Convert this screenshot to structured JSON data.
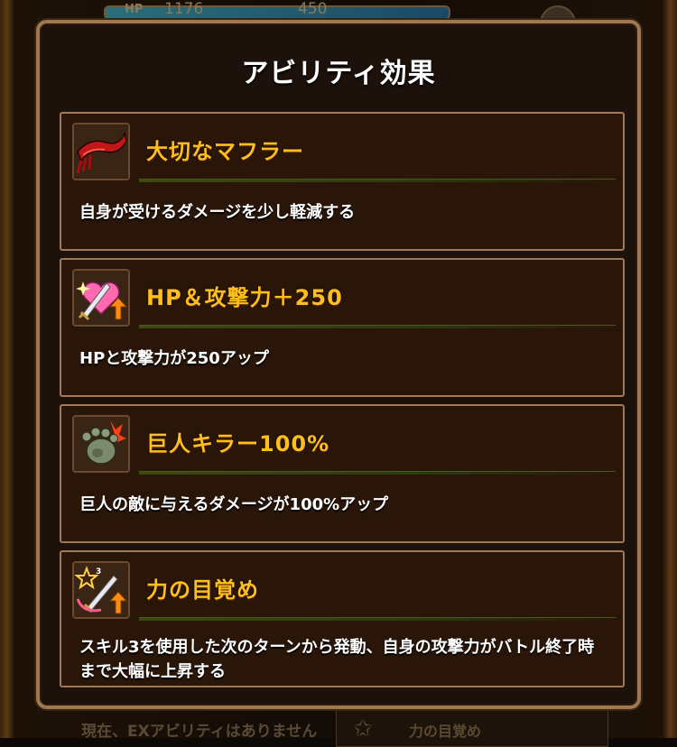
{
  "background": {
    "hp_label": "HP",
    "hp_value": "1176",
    "atk_value": "450",
    "bottom_text": "現在、EXアビリティはありません",
    "bottom_slot_text": "力の目覚め"
  },
  "dialog": {
    "title": "アビリティ効果",
    "abilities": [
      {
        "name": "大切なマフラー",
        "description": "自身が受けるダメージを少し軽減する",
        "icon": "scarf-icon"
      },
      {
        "name": "HP＆攻撃力＋250",
        "description": "HPと攻撃力が250アップ",
        "icon": "heart-sword-up-icon"
      },
      {
        "name": "巨人キラー100%",
        "description": "巨人の敵に与えるダメージが100%アップ",
        "icon": "giant-foot-icon"
      },
      {
        "name": "力の目覚め",
        "description": "スキル3を使用した次のターンから発動、自身の攻撃力がバトル終了時まで大幅に上昇する",
        "icon": "star-sword-up-icon",
        "icon_badge": "3"
      }
    ]
  },
  "colors": {
    "title_text": "#ffffff",
    "ability_name": "#ffbf1a",
    "card_border": "#a0795a",
    "dialog_border": "#a07850"
  }
}
